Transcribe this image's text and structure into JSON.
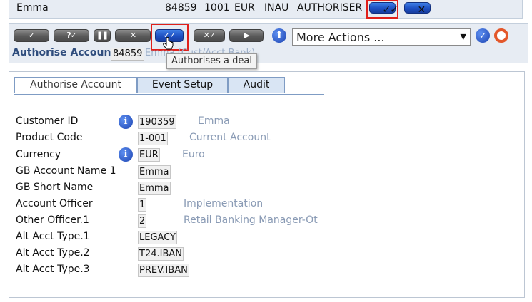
{
  "topbar": {
    "customer": "Emma",
    "account": "84859",
    "product": "1001",
    "currency": "EUR",
    "status": "INAU",
    "role": "AUTHORISER"
  },
  "toolbar": {
    "more_actions": "More Actions ...",
    "tooltip": "Authorises a deal"
  },
  "heading": {
    "title": "Authorise Account",
    "account_id": "84859",
    "tail": "Emma (Cust/Acct Bank)"
  },
  "tabs": [
    "Authorise Account",
    "Event Setup",
    "Audit"
  ],
  "fields": [
    {
      "label": "Customer ID",
      "value": "190359",
      "desc": "Emma",
      "info": true
    },
    {
      "label": "Product Code",
      "value": "1-001",
      "desc": "Current Account",
      "info": false
    },
    {
      "label": "Currency",
      "value": "EUR",
      "desc": "Euro",
      "info": true
    },
    {
      "label": "GB Account Name 1",
      "value": "Emma",
      "desc": "",
      "info": false
    },
    {
      "label": "GB Short Name",
      "value": "Emma",
      "desc": "",
      "info": false
    },
    {
      "label": "Account Officer",
      "value": "1",
      "desc": "Implementation",
      "info": false
    },
    {
      "label": "Other Officer.1",
      "value": "2",
      "desc": "Retail Banking Manager-Ot",
      "info": false
    },
    {
      "label": "Alt Acct Type.1",
      "value": "LEGACY",
      "desc": "",
      "info": false
    },
    {
      "label": "Alt Acct Type.2",
      "value": "T24.IBAN",
      "desc": "",
      "info": false
    },
    {
      "label": "Alt Acct Type.3",
      "value": "PREV.IBAN",
      "desc": "",
      "info": false
    }
  ],
  "colors": {
    "accent": "#2f4d7d",
    "highlight": "#e0201b",
    "description": "#8a9bb5"
  }
}
